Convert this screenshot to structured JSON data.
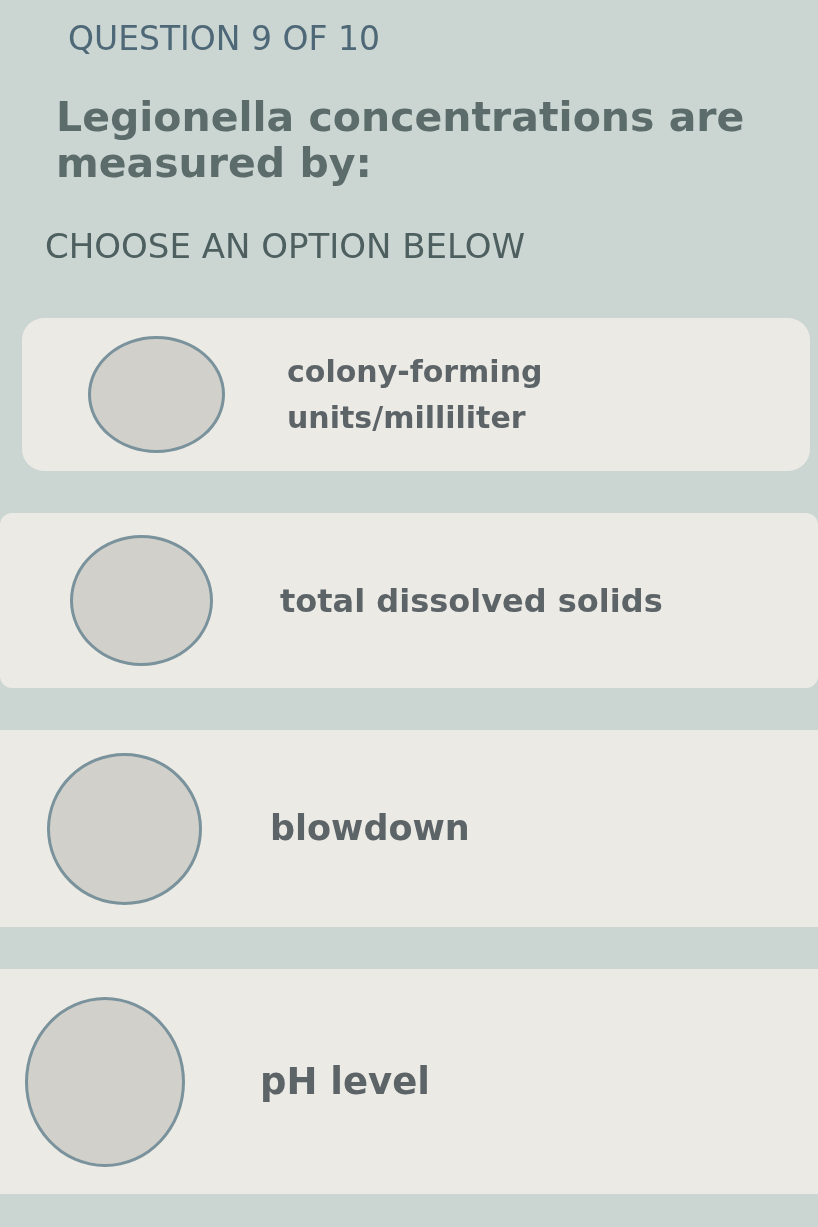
{
  "header": {
    "question_number": "QUESTION 9 OF 10"
  },
  "question": {
    "text": "Legionella concentrations are measured by:"
  },
  "instruction": "CHOOSE AN OPTION BELOW",
  "options": [
    {
      "label": "colony-forming units/milliliter",
      "selected": false
    },
    {
      "label": "total dissolved solids",
      "selected": false
    },
    {
      "label": "blowdown",
      "selected": false
    },
    {
      "label": "pH level",
      "selected": false
    }
  ]
}
